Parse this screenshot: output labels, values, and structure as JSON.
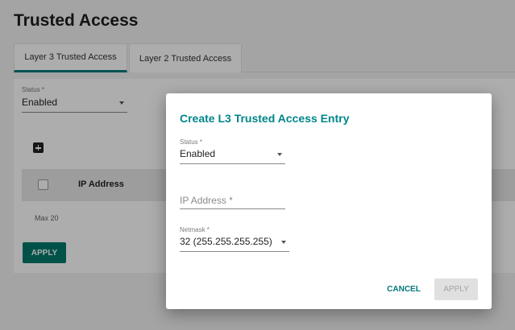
{
  "page": {
    "title": "Trusted Access",
    "tabs": [
      {
        "label": "Layer 3 Trusted Access",
        "active": true
      },
      {
        "label": "Layer 2 Trusted Access",
        "active": false
      }
    ],
    "status_label": "Status *",
    "status_value": "Enabled",
    "table_header_ip": "IP Address",
    "max_label": "Max 20",
    "apply_label": "APPLY"
  },
  "dialog": {
    "title": "Create L3 Trusted Access Entry",
    "status_label": "Status *",
    "status_value": "Enabled",
    "ip_placeholder": "IP Address *",
    "netmask_label": "Netmask *",
    "netmask_value": "32 (255.255.255.255)",
    "cancel_label": "CANCEL",
    "apply_label": "APPLY"
  },
  "colors": {
    "accent": "#00868a",
    "primary_button": "#007a6b"
  },
  "icons": {
    "add": "add-box-icon",
    "dropdown": "caret-down-icon"
  }
}
